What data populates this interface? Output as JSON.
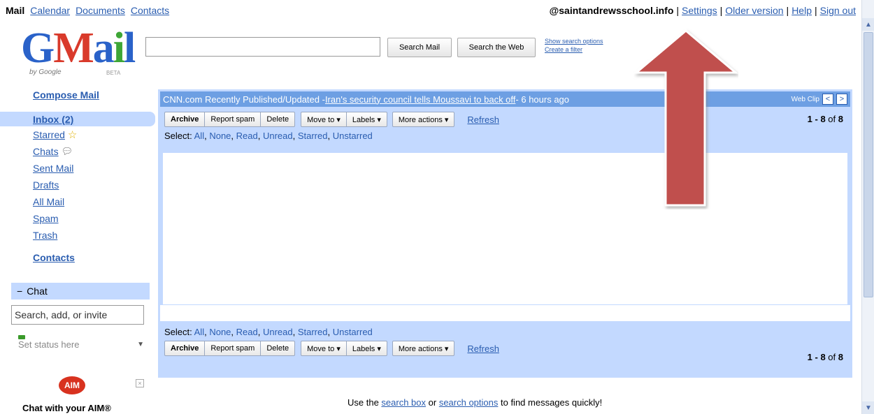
{
  "topnav": {
    "mail": "Mail",
    "calendar": "Calendar",
    "documents": "Documents",
    "contacts": "Contacts"
  },
  "account": {
    "email": "@saintandrewsschool.info",
    "settings": "Settings",
    "older_version": "Older version",
    "help": "Help",
    "sign_out": "Sign out"
  },
  "logo": {
    "g": "G",
    "m": "M",
    "a": "a",
    "i": "i",
    "l": "l",
    "by_google": "by Google",
    "beta": "BETA"
  },
  "search": {
    "value": "",
    "search_mail": "Search Mail",
    "search_web": "Search the Web",
    "show_options": "Show search options",
    "create_filter": "Create a filter"
  },
  "nav": {
    "compose": "Compose Mail",
    "inbox": "Inbox (2)",
    "starred": "Starred",
    "chats": "Chats",
    "sent": "Sent Mail",
    "drafts": "Drafts",
    "all_mail": "All Mail",
    "spam": "Spam",
    "trash": "Trash",
    "contacts": "Contacts"
  },
  "chat": {
    "toggle": "−",
    "title": "Chat",
    "search_placeholder": "Search, add, or invite",
    "status": "Set status here",
    "aim_logo": "AIM",
    "aim_close": "×",
    "aim_text": "Chat with your AIM®"
  },
  "webclip": {
    "source": "CNN.com Recently Published/Updated - ",
    "headline": "Iran's security council tells Moussavi to back off",
    "age": " - 6 hours ago",
    "label": "Web Clip",
    "prev": "<",
    "next": ">"
  },
  "toolbar": {
    "archive": "Archive",
    "report_spam": "Report spam",
    "delete": "Delete",
    "move_to": "Move to ▾",
    "labels": "Labels ▾",
    "more_actions": "More actions ▾",
    "refresh": "Refresh",
    "count_range": "1 - 8",
    "count_of": " of ",
    "count_total": "8"
  },
  "select": {
    "prefix": "Select: ",
    "all": "All",
    "none": "None",
    "read": "Read",
    "unread": "Unread",
    "starred": "Starred",
    "unstarred": "Unstarred"
  },
  "footer": {
    "pre": "Use the ",
    "search_box": "search box",
    "or": " or ",
    "search_options": "search options",
    "post": " to find messages quickly!"
  },
  "colors": {
    "accent": "#c3d9ff",
    "link": "#2a5db0",
    "arrow": "#c0504d"
  }
}
